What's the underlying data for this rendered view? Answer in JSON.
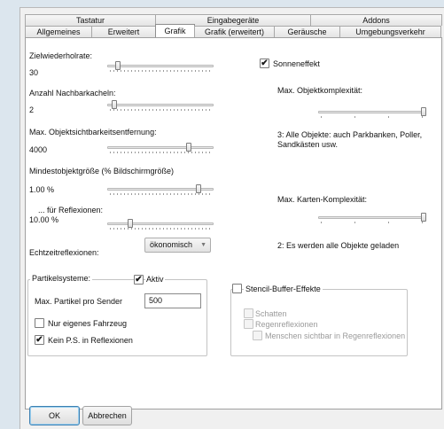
{
  "tabs": {
    "row1": [
      "Tastatur",
      "Eingabegeräte",
      "Addons"
    ],
    "row2": [
      "Allgemeines",
      "Erweitert",
      "Grafik",
      "Grafik (erweitert)",
      "Geräusche",
      "Umgebungsverkehr"
    ],
    "active": "Grafik"
  },
  "settings": {
    "frame_rate": {
      "label": "Zielwiederholrate:",
      "value": "30",
      "slider_fraction": 0.08
    },
    "neighbor_tiles": {
      "label": "Anzahl Nachbarkacheln:",
      "value": "2",
      "slider_fraction": 0.04
    },
    "object_view_distance": {
      "label": "Max. Objektsichtbarkeitsentfernung:",
      "value": "4000",
      "slider_fraction": 0.78
    },
    "min_object_size": {
      "label": "Mindestobjektgröße (% Bildschirmgröße)",
      "value": "1.00 %",
      "slider_fraction": 0.88
    },
    "reflections_size": {
      "label": "... für Reflexionen:",
      "value": "10.00 %",
      "slider_fraction": 0.2
    },
    "realtime_reflections": {
      "label": "Echtzeitreflexionen:",
      "selected": "ökonomisch"
    },
    "sun_effect": {
      "label": "Sonneneffekt",
      "checked": true
    },
    "object_complexity": {
      "label": "Max. Objektkomplexität:",
      "slider_fraction": 1.0,
      "description": "3: Alle Objekte: auch Parkbanken, Poller, Sandkästen usw."
    },
    "map_complexity": {
      "label": "Max. Karten-Komplexität:",
      "slider_fraction": 1.0,
      "description": "2: Es werden alle Objekte geladen"
    }
  },
  "particles": {
    "group_label": "Partikelsysteme:",
    "active_label": "Aktiv",
    "active_checked": true,
    "max_label": "Max. Partikel pro Sender",
    "max_value": "500",
    "own_vehicle_label": "Nur eigenes Fahrzeug",
    "own_vehicle_checked": false,
    "no_reflections_label": "Kein P.S. in Reflexionen",
    "no_reflections_checked": true
  },
  "stencil": {
    "label": "Stencil-Buffer-Effekte",
    "checked": false,
    "shadows_label": "Schatten",
    "rain_label": "Regenreflexionen",
    "people_label": "Menschen sichtbar in Regenreflexionen"
  },
  "buttons": {
    "ok": "OK",
    "cancel": "Abbrechen"
  }
}
